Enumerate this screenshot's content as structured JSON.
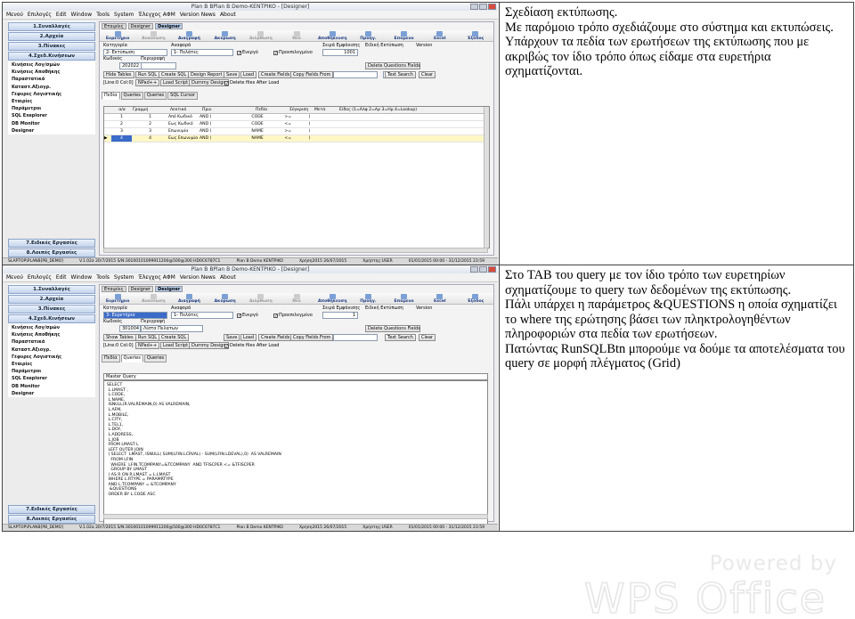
{
  "rows": [
    {
      "paragraphs": [
        "Σχεδίαση εκτύπωσης.",
        "Με παρόμοιο τρόπο σχεδιάζουμε στο σύστημα και εκτυπώσεις.",
        "Υπάρχουν τα πεδία των ερωτήσεων της εκτύπωσης που με ακριβώς τον ίδιο τρόπο όπως είδαμε στα ευρετήρια σχηματίζονται."
      ]
    },
    {
      "paragraphs": [
        "Στο TAB του query με τον ίδιο τρόπο των ευρετηρίων σχηματίζουμε το query των δεδομένων της εκτύπωσης.",
        "Πάλι υπάρχει η παράμετρος &QUESTIONS η οποία σχηματίζει το where της ερώτησης βάσει των πληκτρολογηθέντων πληροφοριών στα πεδία των ερωτήσεων.",
        "Πατώντας RunSQLBtn μπορούμε να δούμε τα αποτελέσματα του query σε μορφή πλέγματος (Grid)"
      ]
    }
  ],
  "app": {
    "title": "Plan B BPlan B Demo-KENTPIKO - [Designer]",
    "menu": [
      "Μενού",
      "Επιλογές",
      "Edit",
      "Window",
      "Tools",
      "System",
      "Έλεγχος ΑΦΜ",
      "Version News",
      "About"
    ],
    "sidebar_top": [
      "1.Συναλλαγές",
      "2.Αρχεία",
      "3.Πίνακες",
      "4.Σχεδ.Κινήσεων"
    ],
    "sidebar_items": [
      "Κινήσεις Λογ/σμών",
      "Κινήσεις Αποθήκης",
      "Παραστατικά",
      "Καταστ.Αξιογρ.",
      "Γέφυρες Λογιστικής",
      "Εταιρίες",
      "Παράμετροι",
      "SQL Exeplorer",
      "DB Monitor",
      "Designer"
    ],
    "sidebar_bottom": [
      "7.Ειδικές Εργασίες",
      "8.Λοιπές Εργασίες"
    ],
    "window_tabs": [
      "Εταιρίες",
      "Designer",
      "Designer"
    ],
    "ribbon": [
      "Ευρετήριο",
      "Ανανέωση",
      "Διαγραφή",
      "Ακύρωση",
      "Διόρθωση",
      "Νέο",
      "Αποθήκευση",
      "Προηγ.",
      "Επόμενο",
      "Excel",
      "Έξοδος"
    ],
    "labels": {
      "category": "Κατηγορία",
      "reference": "Αναφορά",
      "code": "Κωδικός",
      "description": "Περιγραφή",
      "display_order": "Σειρά Εμφάνισης",
      "special_print": "Ειδική Εκτύπωση",
      "version": "Version",
      "active": "Ενεργό",
      "selected": "Προεπιλεγμένο",
      "delete_files": "Delete files After Load"
    },
    "buttons_row1": [
      "Hide Tables",
      "Run SQL",
      "Create SQL",
      "Design Report",
      "Save",
      "Load",
      "Create Fields",
      "Copy Fields From"
    ],
    "buttons_row1_b": [
      "Show Tables",
      "Run SQL",
      "Create SQL"
    ],
    "buttons_right": [
      "Text Search",
      "Clear"
    ],
    "buttons_row2": [
      "NPad++",
      "Load Script",
      "Dummy Design"
    ],
    "delete_qfields": "Delete Questions Fields",
    "status": [
      "SLAPTOP\\PLANB[PB_DEMO]",
      "V.1.02a 20/7/2015 S/N:30100101099911200@500@300 HD0C6787C1",
      "Plan B Demo KENTPIKO",
      "Χρήση2015 26/07/2015",
      "Χρήστης:USER",
      "01/01/2015 00:00 - 31/12/2015 23:59"
    ]
  },
  "shot1": {
    "category": "2- Εκτύπωση",
    "reference": "1- Πελάτες",
    "code": "202022",
    "description": "",
    "order": "1001",
    "linecol": "[Line:0  Col:0]",
    "tabs": [
      "Πεδία",
      "Queries",
      "Queries",
      "SQL Cursor"
    ],
    "columns": [
      "α/α",
      "Γραμμή",
      "Λεκτικό",
      "Πριν",
      "Πεδίο",
      "Σύγκριση",
      "Μετά",
      "Είδος (1=Αλφ 2=Αρ 3=Ημ 4=Lookup)",
      ""
    ],
    "grid": [
      [
        "1",
        "1",
        "Από Κωδικό",
        "AND (",
        "CODE",
        ">=",
        ")",
        "31"
      ],
      [
        "2",
        "2",
        "Εως Κωδικό",
        "AND (",
        "CODE",
        "<=",
        ")",
        "31"
      ],
      [
        "3",
        "3",
        "Επωνυμία",
        "AND (",
        "NAME",
        ">=",
        ")",
        "31"
      ],
      [
        "4",
        "4",
        "Εως Επωνυμία",
        "AND (",
        "NAME",
        "<=",
        ")",
        "31"
      ]
    ]
  },
  "shot2": {
    "category": "3- Ευρετήριο",
    "reference": "1- Πελάτες",
    "code": "301004",
    "description": "Λίστα Πελατών",
    "order": "1",
    "linecol": "[Line:0  Col:0]",
    "tabs": [
      "Πεδία",
      "Queries",
      "Queries"
    ],
    "query_title": "Master Query",
    "query_text": "SELECT\n L.LMAST ,\n L.CODE,\n L.NAME,\n ISNULL(R.VALREMAIN,0) AS VALREMAIN,\n L.AFM,\n L.MOBILE,\n L.CITY,\n L.TEL1,\n L.DOY,\n L.ADDRESS,\n L.JOB\n FROM LMAST L\n LEFT OUTER JOIN\n ( SELECT  LMAST, ISNULL( SUM(LFIN.LCRVAL) - SUM(LFIN.LDEVAL),0)  AS VALREMAIN\n   FROM LFIN\n   WHERE  LFIN.TCOMPANY=&TCOMPANY  AND TFISCPER <= &TFISCPER\n   GROUP BY LMAST\n ) AS R ON R.LMAST = L.LMAST\n WHERE L.RTYPE = PARAMRTYPE\n AND L.TCOMPANY = &TCOMPANY\n  &QUESTIONS\n ORDER BY L.CODE ASC"
  },
  "watermark": {
    "powered": "Powered by",
    "brand": "WPS Office"
  }
}
